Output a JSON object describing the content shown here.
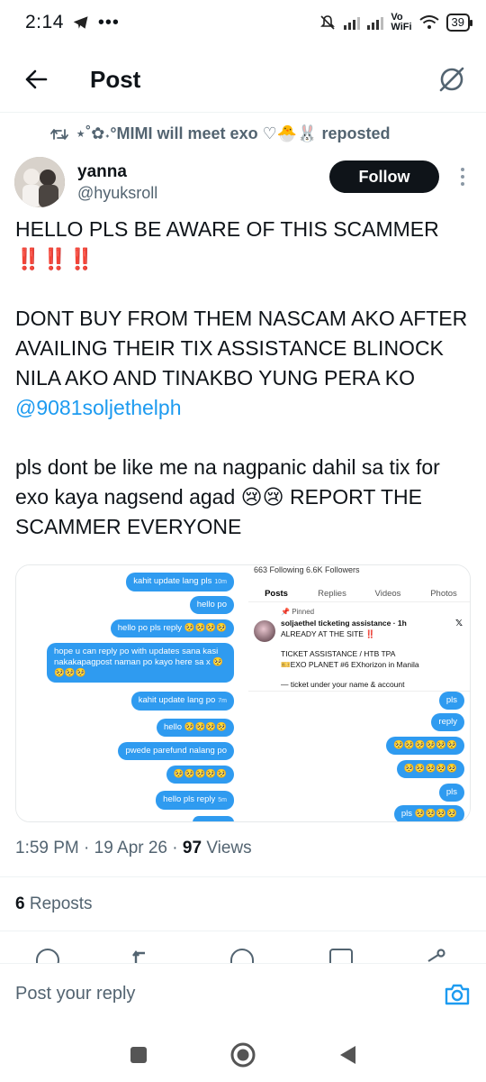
{
  "status_bar": {
    "time": "2:14",
    "vowifi_top": "Vo",
    "vowifi_bottom": "WiFi",
    "battery": "39"
  },
  "header": {
    "title": "Post"
  },
  "repost_banner": {
    "text": "⋆˚✿˖°MIMI will meet exo ♡🐣🐰 reposted"
  },
  "author": {
    "display_name": "yanna",
    "username": "@hyuksroll",
    "follow_label": "Follow"
  },
  "tweet": {
    "line1": "HELLO PLS BE AWARE OF THIS SCAMMER",
    "line1_emoji": "‼️‼️‼️",
    "paragraph2": "DONT BUY FROM THEM NASCAM AKO AFTER AVAILING THEIR TIX ASSISTANCE BLINOCK NILA AKO AND TINAKBO YUNG PERA KO",
    "mention": "@9081soljethelph",
    "paragraph3": "pls dont be like me na nagpanic dahil sa tix for exo kaya nagsend agad 😢😢 REPORT THE SCAMMER EVERYONE"
  },
  "media": {
    "left_messages": [
      {
        "text": "kahit update lang pls",
        "time": "10m"
      },
      {
        "text": "hello po",
        "time": ""
      },
      {
        "text": "hello po pls reply 🥺🥺🥺🥺",
        "time": ""
      },
      {
        "text": "hope u can reply po with updates sana kasi nakakapagpost naman po kayo here sa x 🥺🥺🥺🥺",
        "time": ""
      },
      {
        "text": "kahit update lang po",
        "time": "7m"
      },
      {
        "text": "hello 🥺🥺🥺🥺",
        "time": ""
      },
      {
        "text": "pwede parefund nalang po",
        "time": ""
      },
      {
        "text": "🥺🥺🥺🥺🥺",
        "time": ""
      },
      {
        "text": "hello pls reply",
        "time": "5m"
      }
    ],
    "right_stats": "663 Following  6.6K Followers",
    "right_tabs": [
      "Posts",
      "Replies",
      "Videos",
      "Photos"
    ],
    "pinned_label": "Pinned",
    "card_name": "soljaethel ticketing assistance · 1h",
    "card_line1": "ALREADY AT THE SITE ‼️",
    "card_line2": "TICKET ASSISTANCE / HTB TPA",
    "card_line3": "🎫EXO PLANET #6 EXhorizon in Manila",
    "card_line4": "— ticket under your name & account",
    "right_messages": [
      {
        "text": "pls"
      },
      {
        "text": "reply"
      },
      {
        "text": "🥺🥺🥺🥺🥺🥺"
      },
      {
        "text": "🥺🥺🥺🥺🥺"
      },
      {
        "text": "pls"
      },
      {
        "text": "pls 🥺🥺🥺🥺"
      }
    ]
  },
  "meta": {
    "time": "1:59 PM",
    "date": "19 Apr 26",
    "views_count": "97",
    "views_label": "Views"
  },
  "reposts": {
    "count": "6",
    "label": "Reposts"
  },
  "reply_bar": {
    "placeholder": "Post your reply"
  },
  "colors": {
    "accent": "#1d9bf0",
    "text": "#0f1419",
    "muted": "#536471",
    "dm_bubble": "#2f9bf0"
  }
}
